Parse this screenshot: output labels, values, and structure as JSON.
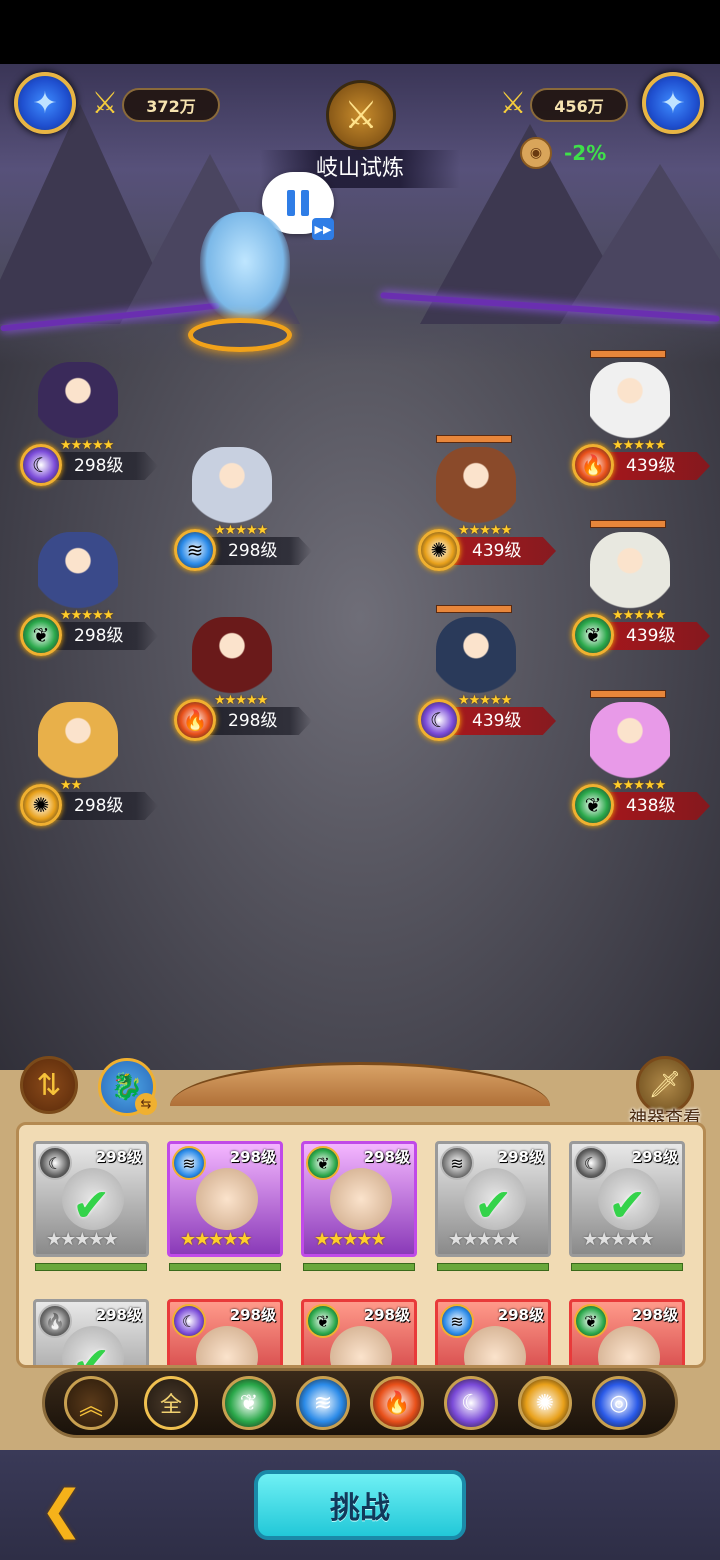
{
  "hud": {
    "left_power": "372万",
    "right_power": "456万",
    "stage_title": "岐山试炼",
    "modifier_pct": "-2%",
    "pause_icon": "pause-icon",
    "speed_icon": "fast-forward-icon"
  },
  "allies": [
    {
      "level": "298级",
      "stars": "★★★★★",
      "element": "moon",
      "color": "#7a4ad8",
      "sprite_color": "#3a2a5a"
    },
    {
      "level": "298级",
      "stars": "★★★★★",
      "element": "water",
      "color": "#2a8ae8",
      "sprite_color": "#c8d0e0"
    },
    {
      "level": "298级",
      "stars": "★★★★★",
      "element": "wood",
      "color": "#2aa84a",
      "sprite_color": "#3a4a8a"
    },
    {
      "level": "298级",
      "stars": "★★★★★",
      "element": "fire",
      "color": "#e8501a",
      "sprite_color": "#6a1a1a"
    },
    {
      "level": "298级",
      "stars": "★★",
      "element": "sun",
      "color": "#e8a01a",
      "sprite_color": "#e8b04a"
    }
  ],
  "enemies": [
    {
      "level": "439级",
      "stars": "★★★★★",
      "element": "fire",
      "color": "#e8501a",
      "sprite_color": "#f0f0f0"
    },
    {
      "level": "439级",
      "stars": "★★★★★",
      "element": "sun",
      "color": "#e8a01a",
      "sprite_color": "#8a4a2a"
    },
    {
      "level": "439级",
      "stars": "★★★★★",
      "element": "wood",
      "color": "#2aa84a",
      "sprite_color": "#e8e8e0"
    },
    {
      "level": "439级",
      "stars": "★★★★★",
      "element": "moon",
      "color": "#7a4ad8",
      "sprite_color": "#2a3a5a"
    },
    {
      "level": "438级",
      "stars": "★★★★★",
      "element": "wood",
      "color": "#2aa84a",
      "sprite_color": "#e89ae8"
    }
  ],
  "panel": {
    "artifact_label": "神器查看",
    "swap_icon": "swap-icon",
    "pet_icon": "dragon-pet-icon"
  },
  "roster": [
    {
      "level": "298级",
      "state": "used",
      "element": "moon"
    },
    {
      "level": "298级",
      "state": "active",
      "element": "water"
    },
    {
      "level": "298级",
      "state": "active",
      "element": "wood"
    },
    {
      "level": "298级",
      "state": "used",
      "element": "water"
    },
    {
      "level": "298级",
      "state": "used",
      "element": "moon"
    },
    {
      "level": "298级",
      "state": "used",
      "element": "fire"
    },
    {
      "level": "298级",
      "state": "active",
      "element": "moon"
    },
    {
      "level": "298级",
      "state": "active",
      "element": "wood"
    },
    {
      "level": "298级",
      "state": "active",
      "element": "water"
    },
    {
      "level": "298级",
      "state": "active",
      "element": "wood"
    }
  ],
  "filters": {
    "collapse_icon": "double-chevron-up-icon",
    "all_label": "全",
    "elements": [
      "wood",
      "water",
      "fire",
      "moon",
      "sun",
      "whirl"
    ]
  },
  "bottom": {
    "challenge_label": "挑战",
    "back_icon": "back-arrow-icon"
  }
}
